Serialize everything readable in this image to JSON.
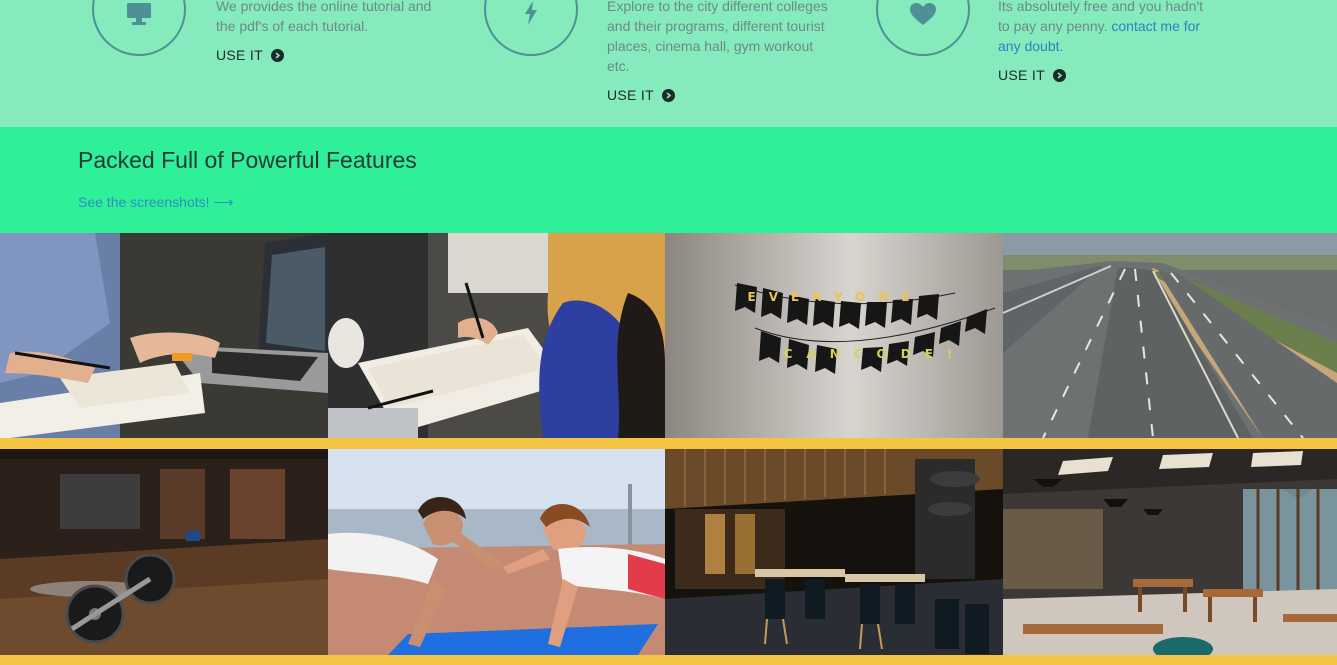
{
  "services": [
    {
      "icon": "monitor-icon",
      "text_lines": [
        "We provides the online tutorial and",
        "the pdf's of each tutorial."
      ],
      "link_text": "",
      "use_label": "USE IT"
    },
    {
      "icon": "lightning-icon",
      "text_lines": [
        "Explore to the city different colleges",
        "and their programs, different tourist",
        "places, cinema hall, gym workout",
        "etc."
      ],
      "link_text": "",
      "use_label": "USE IT"
    },
    {
      "icon": "heart-icon",
      "text_lines": [
        "Its absolutely free and you hadn't",
        "to pay any penny.",
        "any doubt."
      ],
      "link_text": "contact me for",
      "use_label": "USE IT"
    }
  ],
  "features": {
    "title": "Packed Full of Powerful Features",
    "link": "See the screenshots! ⟶"
  },
  "gallery": {
    "banner_text_top": "EVERYONE",
    "banner_text_bottom": "CAN CODE!"
  },
  "colors": {
    "services_bg": "#85ebbd",
    "features_bg": "#2ff098",
    "gallery_gap": "#f4c542",
    "link": "#2a8fc4"
  }
}
